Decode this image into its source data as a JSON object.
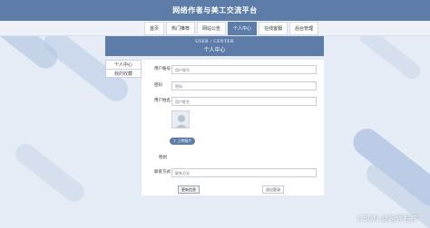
{
  "app": {
    "title": "网络作者与美工交流平台"
  },
  "nav": {
    "items": [
      {
        "label": "首页",
        "active": false
      },
      {
        "label": "热门推荐",
        "active": false
      },
      {
        "label": "网站公告",
        "active": false
      },
      {
        "label": "个人中心",
        "active": true
      },
      {
        "label": "在线客服",
        "active": false
      },
      {
        "label": "后台管理",
        "active": false
      }
    ]
  },
  "panel": {
    "title_en": "USER / CENTER",
    "title_cn": "个人中心"
  },
  "sidebar": {
    "items": [
      {
        "label": "个人中心",
        "active": true
      },
      {
        "label": "我的收藏",
        "active": false
      }
    ]
  },
  "form": {
    "account_label": "用户账号",
    "account_placeholder": "用户账号",
    "password_label": "密码",
    "password_placeholder": "密码",
    "name_label": "用户姓名",
    "name_placeholder": "用户姓名",
    "upload_label": "上传图片",
    "gender_label": "性别",
    "contact_label": "联系方式",
    "contact_placeholder": "联系方式",
    "save_label": "更新信息",
    "logout_label": "退出登录"
  },
  "watermark": "CSDN @跨界程序",
  "colors": {
    "accent": "#5d7ca8",
    "background": "#e6ecf5"
  }
}
